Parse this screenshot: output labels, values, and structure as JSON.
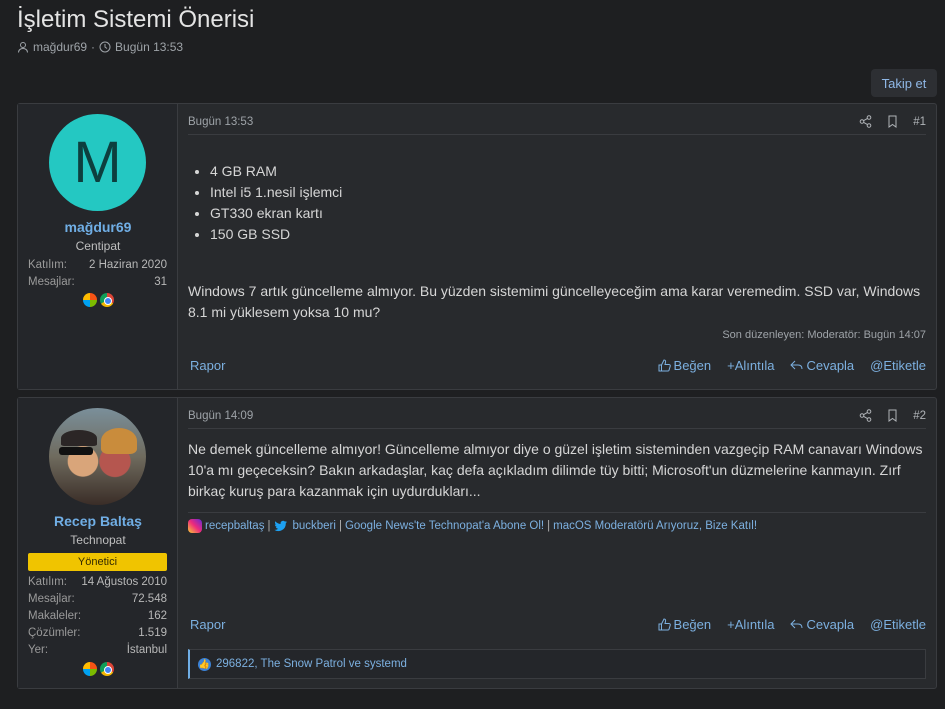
{
  "thread": {
    "title": "İşletim Sistemi Önerisi",
    "author": "mağdur69",
    "date": "Bugün 13:53",
    "follow_label": "Takip et"
  },
  "posts": [
    {
      "date": "Bugün 13:53",
      "number": "#1",
      "user": {
        "avatar_letter": "M",
        "avatar_color": "#24c8c2",
        "name": "mağdur69",
        "title": "Centipat",
        "stats": [
          {
            "key": "Katılım:",
            "value": "2 Haziran 2020"
          },
          {
            "key": "Mesajlar:",
            "value": "31"
          }
        ]
      },
      "specs": [
        "4 GB RAM",
        "Intel i5 1.nesil işlemci",
        "GT330 ekran kartı",
        "150 GB SSD"
      ],
      "text": "Windows 7 artık güncelleme almıyor. Bu yüzden sistemimi güncelleyeceğim ama karar veremedim. SSD var, Windows 8.1 mi yüklesem yoksa 10 mu?",
      "edited": "Son düzenleyen: Moderatör: Bugün 14:07",
      "footer": {
        "report": "Rapor",
        "like": "Beğen",
        "quote": "+Alıntıla",
        "reply": "Cevapla",
        "tag": "@Etiketle"
      }
    },
    {
      "date": "Bugün 14:09",
      "number": "#2",
      "user": {
        "name": "Recep Baltaş",
        "title": "Technopat",
        "badge": "Yönetici",
        "badge_color": "#f0c400",
        "stats": [
          {
            "key": "Katılım:",
            "value": "14 Ağustos 2010"
          },
          {
            "key": "Mesajlar:",
            "value": "72.548"
          },
          {
            "key": "Makaleler:",
            "value": "162"
          },
          {
            "key": "Çözümler:",
            "value": "1.519"
          },
          {
            "key": "Yer:",
            "value": "İstanbul"
          }
        ]
      },
      "text": "Ne demek güncelleme almıyor! Güncelleme almıyor diye o güzel işletim sisteminden vazgeçip RAM canavarı Windows 10'a mı geçeceksin? Bakın arkadaşlar, kaç defa açıkladım dilimde tüy bitti; Microsoft'un düzmelerine kanmayın. Zırf birkaç kuruş para kazanmak için uydurdukları...",
      "signature": {
        "instagram": "recepbaltaş",
        "twitter": "buckberi",
        "link1": "Google News'te Technopat'a Abone Ol!",
        "link2": "macOS Moderatörü Arıyoruz, Bize Katıl!"
      },
      "footer": {
        "report": "Rapor",
        "like": "Beğen",
        "quote": "+Alıntıla",
        "reply": "Cevapla",
        "tag": "@Etiketle"
      },
      "reactions": "296822, The Snow Patrol ve systemd"
    }
  ]
}
